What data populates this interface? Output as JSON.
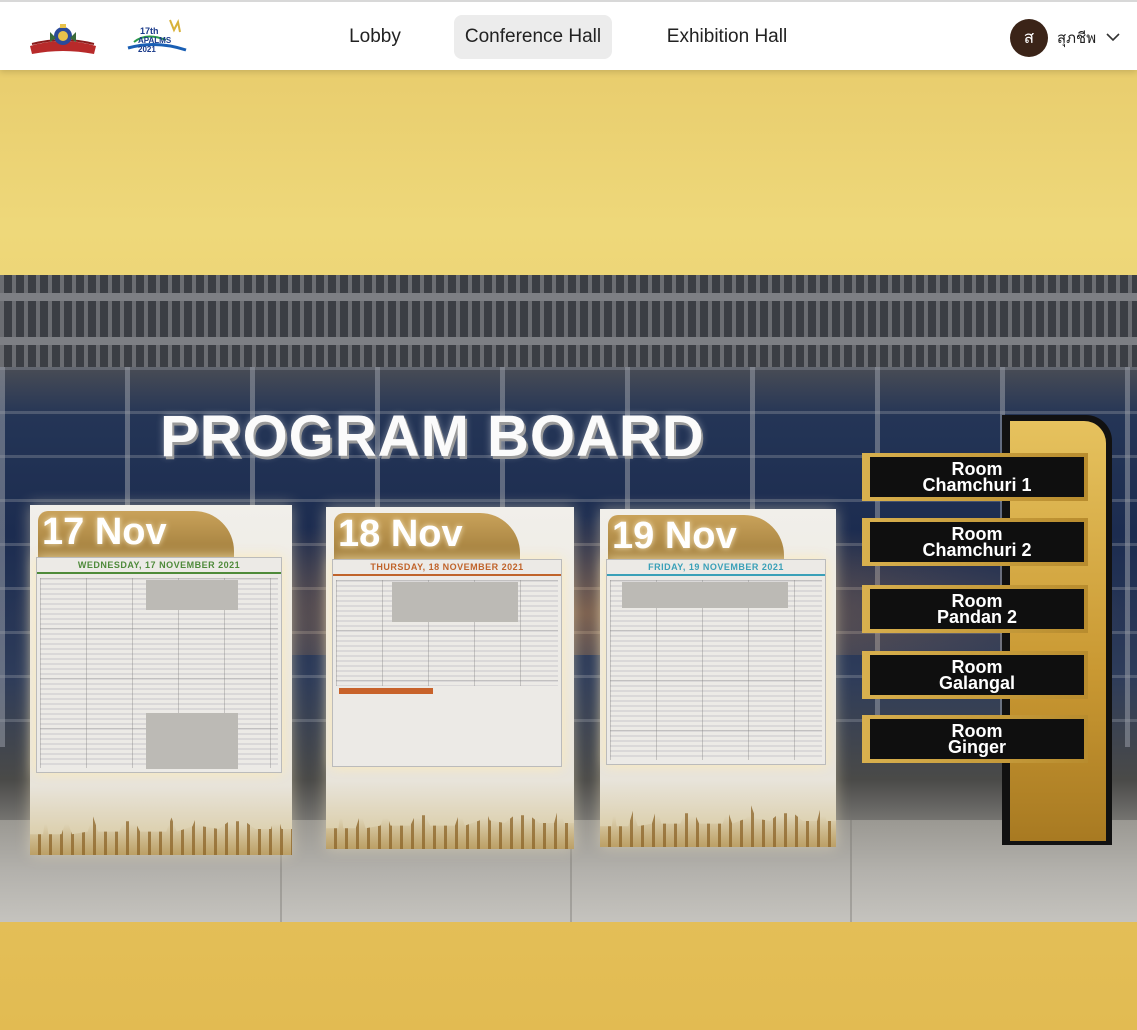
{
  "header": {
    "logo1_alt": "Society emblem",
    "logo2": {
      "number": "17th",
      "name": "APALMS 2021"
    },
    "nav": [
      {
        "label": "Lobby",
        "active": false
      },
      {
        "label": "Conference Hall",
        "active": true
      },
      {
        "label": "Exhibition Hall",
        "active": false
      }
    ],
    "user": {
      "initial": "ส",
      "name": "สุภชีพ",
      "menu_icon": "chevron-down-icon"
    }
  },
  "scene": {
    "title": "PROGRAM BOARD",
    "boards": [
      {
        "date": "17 Nov",
        "heading": "WEDNESDAY, 17 NOVEMBER 2021",
        "heading_color": "#4e8a3a"
      },
      {
        "date": "18 Nov",
        "heading": "THURSDAY, 18 NOVEMBER 2021",
        "heading_color": "#c0632a"
      },
      {
        "date": "19 Nov",
        "heading": "FRIDAY, 19 NOVEMBER 2021",
        "heading_color": "#3aa0b8"
      }
    ],
    "rooms": [
      {
        "line1": "Room",
        "line2": "Chamchuri 1"
      },
      {
        "line1": "Room",
        "line2": "Chamchuri 2"
      },
      {
        "line1": "Room",
        "line2": "Pandan 2"
      },
      {
        "line1": "Room",
        "line2": "Galangal"
      },
      {
        "line1": "Room",
        "line2": "Ginger"
      }
    ]
  },
  "colors": {
    "accent": "#3b2418",
    "gold": "#c99832",
    "background": "#e9cc6a"
  }
}
